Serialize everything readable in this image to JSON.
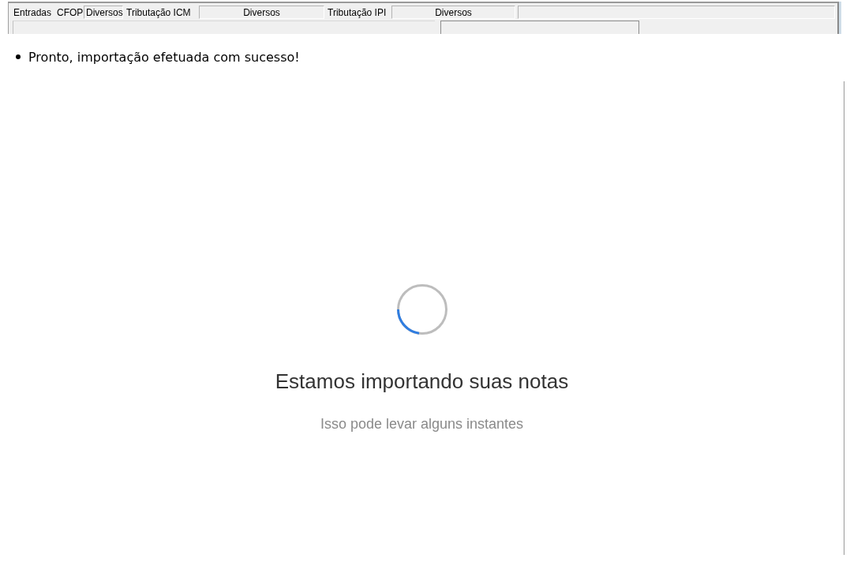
{
  "form": {
    "row_1": [
      {
        "kind": "label",
        "text": "Entradas"
      },
      {
        "kind": "label",
        "text": "CFOP"
      },
      {
        "kind": "field",
        "text": "Diversos"
      },
      {
        "kind": "label",
        "text": "Tributação ICM"
      },
      {
        "kind": "field",
        "text": "Diversos"
      },
      {
        "kind": "label",
        "text": "Tributação IPI"
      },
      {
        "kind": "field",
        "text": "Diversos"
      },
      {
        "kind": "field"
      }
    ],
    "row_2": [
      {
        "kind": "field"
      },
      {
        "kind": "field"
      }
    ]
  },
  "messages": [
    "Pronto, importação efetuada com sucesso!"
  ],
  "loading": {
    "title": "Estamos importando suas notas",
    "subtitle": "Isso pode levar alguns instantes"
  }
}
